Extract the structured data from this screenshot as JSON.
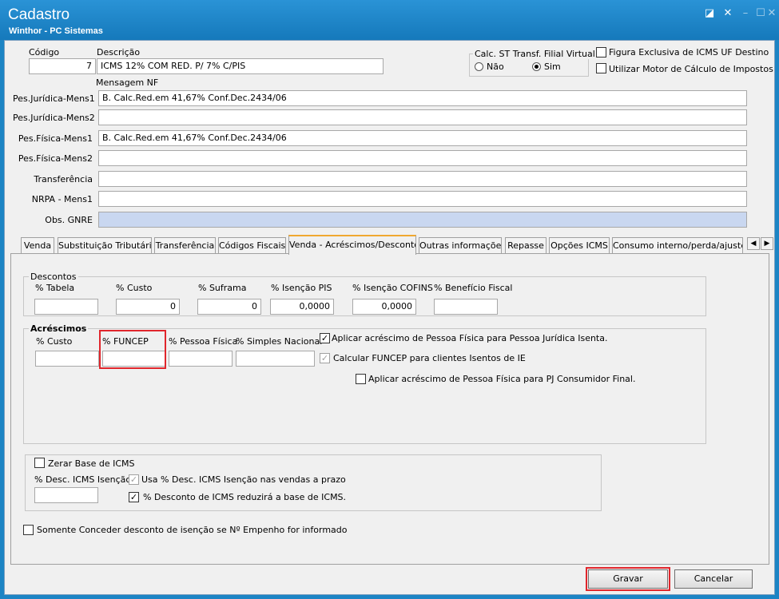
{
  "window": {
    "title": "Cadastro",
    "subtitle": "Winthor - PC Sistemas",
    "controls": {
      "restore": "◪",
      "close": "✕",
      "minimize": "–",
      "maximize": "☐",
      "close2": "✕"
    }
  },
  "header": {
    "codigo_label": "Código",
    "codigo_value": "7",
    "descricao_label": "Descrição",
    "descricao_value": "ICMS 12% COM RED. P/ 7% C/PIS",
    "calc_st_label": "Calc. ST Transf. Filial Virtual",
    "calc_st_nao": "Não",
    "calc_st_sim": "Sim",
    "figura_exclusiva": "Figura Exclusiva de ICMS UF Destino",
    "utilizar_motor": "Utilizar Motor de Cálculo de Impostos",
    "mensagem_nf_label": "Mensagem NF"
  },
  "messages": [
    {
      "label": "Pes.Jurídica-Mens1",
      "value": "B. Calc.Red.em 41,67% Conf.Dec.2434/06"
    },
    {
      "label": "Pes.Jurídica-Mens2",
      "value": ""
    },
    {
      "label": "Pes.Física-Mens1",
      "value": "B. Calc.Red.em 41,67% Conf.Dec.2434/06"
    },
    {
      "label": "Pes.Física-Mens2",
      "value": ""
    },
    {
      "label": "Transferência",
      "value": ""
    },
    {
      "label": "NRPA - Mens1",
      "value": ""
    },
    {
      "label": "Obs. GNRE",
      "value": ""
    }
  ],
  "tabs": [
    "Venda",
    "Substituição Tributária",
    "Transferência",
    "Códigos Fiscais",
    "Venda - Acréscimos/Descontos",
    "Outras informações",
    "Repasse",
    "Opções ICMS",
    "Consumo interno/perda/ajuste"
  ],
  "tab_scroll": {
    "left": "◀",
    "right": "▶"
  },
  "descontos": {
    "title": "Descontos",
    "fields": [
      {
        "label": "% Tabela",
        "value": ""
      },
      {
        "label": "% Custo",
        "value": "0"
      },
      {
        "label": "% Suframa",
        "value": "0"
      },
      {
        "label": "% Isenção PIS",
        "value": "0,0000"
      },
      {
        "label": "% Isenção COFINS",
        "value": "0,0000"
      },
      {
        "label": "% Benefício Fiscal",
        "value": ""
      }
    ]
  },
  "acrescimos": {
    "title": "Acréscimos",
    "fields": [
      {
        "label": "% Custo",
        "value": ""
      },
      {
        "label": "% FUNCEP",
        "value": ""
      },
      {
        "label": "% Pessoa Física",
        "value": ""
      },
      {
        "label": "% Simples Nacional",
        "value": ""
      }
    ],
    "aplicar_pf_pj_isento": "Aplicar acréscimo de Pessoa Física para Pessoa Jurídica Isenta.",
    "calcular_funcep": "Calcular FUNCEP para clientes Isentos de IE",
    "aplicar_pf_pj_consumidor": "Aplicar acréscimo de Pessoa Física para PJ Consumidor Final."
  },
  "icms": {
    "zerar_base": "Zerar Base de ICMS",
    "desc_icms_isencao_label": "% Desc. ICMS Isenção",
    "desc_icms_isencao_value": "",
    "usa_desc_prazo": "Usa % Desc. ICMS Isenção nas vendas a prazo",
    "desc_reduzira_base": "% Desconto de ICMS reduzirá a base de ICMS."
  },
  "somente_conceder": "Somente Conceder desconto de isenção se Nº Empenho for informado",
  "check_mark": "✓",
  "buttons": {
    "gravar": "Gravar",
    "cancelar": "Cancelar"
  }
}
